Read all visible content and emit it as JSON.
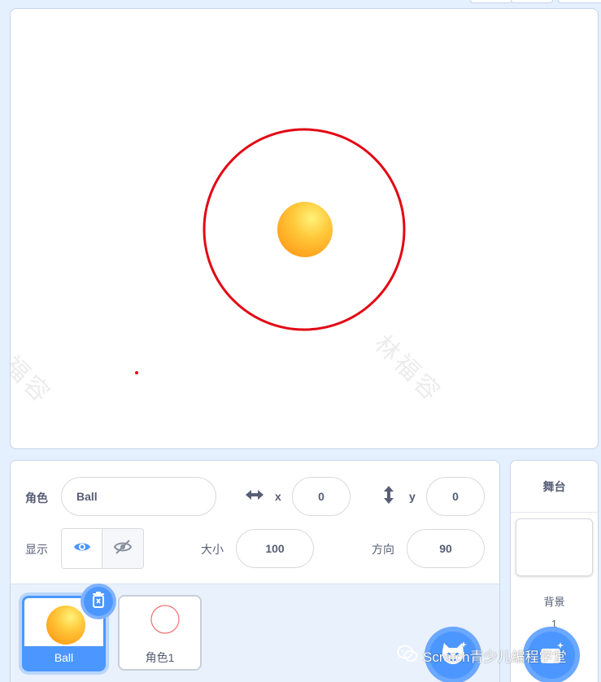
{
  "stage": {
    "watermark_text": "林福容"
  },
  "sprite_info": {
    "sprite_label": "角色",
    "sprite_name": "Ball",
    "x_label": "x",
    "x_value": "0",
    "y_label": "y",
    "y_value": "0",
    "show_label": "显示",
    "size_label": "大小",
    "size_value": "100",
    "direction_label": "方向",
    "direction_value": "90"
  },
  "sprites": [
    {
      "name": "Ball",
      "selected": true
    },
    {
      "name": "角色1",
      "selected": false
    }
  ],
  "stage_pane": {
    "title": "舞台",
    "backdrops_label": "背景",
    "backdrops_count": "1"
  },
  "overlay": {
    "channel_text": "Scratch青少儿编程学堂"
  },
  "colors": {
    "accent": "#4c97ff",
    "circle": "#e30613",
    "ball": "#ffb22c"
  }
}
